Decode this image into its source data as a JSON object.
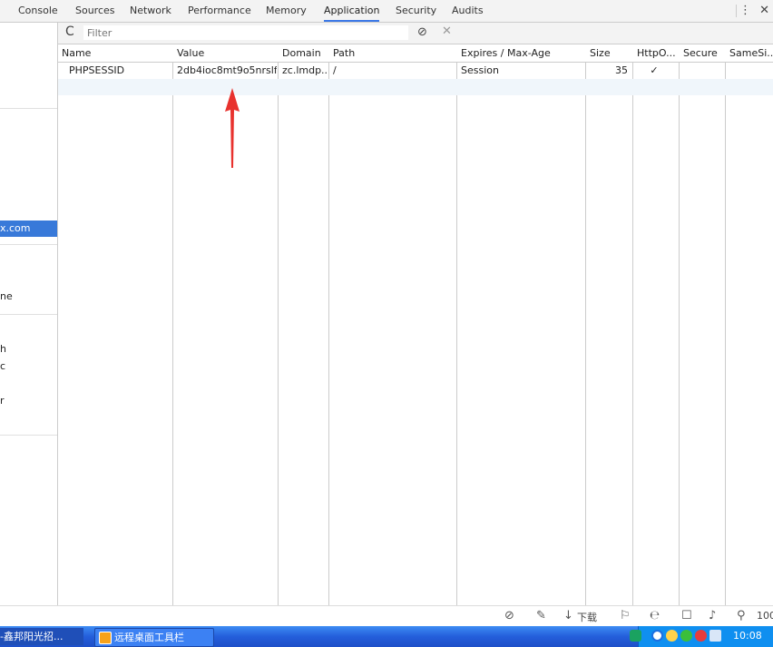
{
  "tabs": [
    {
      "label": "Console",
      "active": false
    },
    {
      "label": "Sources",
      "active": false
    },
    {
      "label": "Network",
      "active": false
    },
    {
      "label": "Performance",
      "active": false
    },
    {
      "label": "Memory",
      "active": false
    },
    {
      "label": "Application",
      "active": true
    },
    {
      "label": "Security",
      "active": false
    },
    {
      "label": "Audits",
      "active": false
    }
  ],
  "topbar": {
    "more_icon": "⋮",
    "close_icon": "✕"
  },
  "sidebar": {
    "items": [
      {
        "label": "x.com",
        "selected": true
      },
      {
        "label": "ne",
        "selected": false
      },
      {
        "label": "h",
        "selected": false
      },
      {
        "label": "c",
        "selected": false
      },
      {
        "label": "r",
        "selected": false
      }
    ]
  },
  "toolbar": {
    "refresh_icon": "C",
    "filter_placeholder": "Filter",
    "clear_all_icon": "⊘",
    "delete_icon": "✕"
  },
  "table": {
    "columns": [
      "Name",
      "Value",
      "Domain",
      "Path",
      "Expires / Max-Age",
      "Size",
      "HttpO...",
      "Secure",
      "SameSi..."
    ],
    "rows": [
      {
        "name": "PHPSESSID",
        "value": "2db4ioc8mt9o5nrslf...",
        "domain": "zc.lmdp...",
        "path": "/",
        "expires": "Session",
        "size": "35",
        "httponly": "✓",
        "secure": "",
        "samesite": ""
      }
    ]
  },
  "statusbar": {
    "download_label": "下载",
    "zoom_label": "100"
  },
  "taskbar": {
    "task1_label": "-鑫邦阳光招...",
    "task2_label": "远程桌面工具栏",
    "clock": "10:08"
  },
  "colors": {
    "accent": "#3879d9",
    "annotation_arrow": "#e8322e",
    "taskbar": "#245edb"
  }
}
